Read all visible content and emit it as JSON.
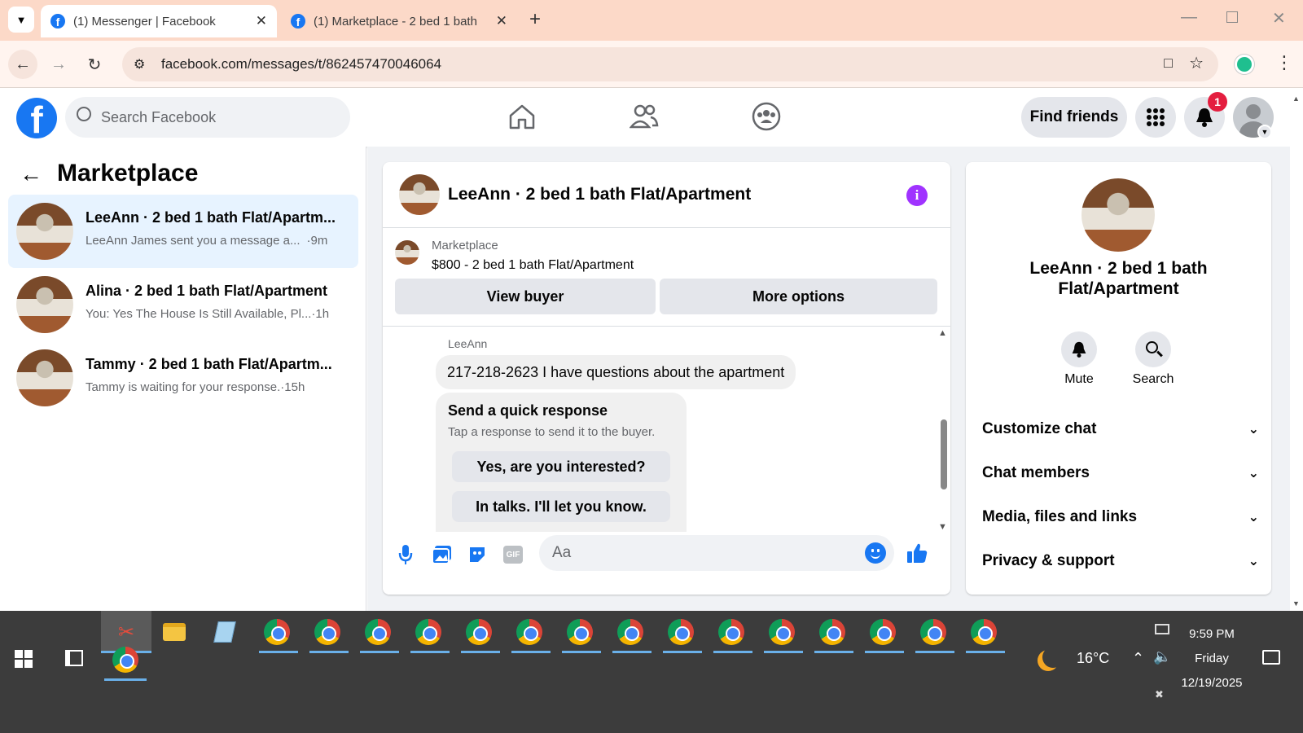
{
  "browser": {
    "tabs": [
      {
        "title": "(1) Messenger | Facebook"
      },
      {
        "title": "(1) Marketplace - 2 bed 1 bath"
      }
    ],
    "url": "facebook.com/messages/t/862457470046064"
  },
  "fb": {
    "search_placeholder": "Search Facebook",
    "find_friends": "Find friends",
    "notification_count": "1",
    "brand_color": "#1877f2"
  },
  "marketplace": {
    "title": "Marketplace",
    "conversations": [
      {
        "name": "LeeAnn · 2 bed 1 bath Flat/Apartm...",
        "preview": "LeeAnn James sent you a message a...",
        "time": "·9m"
      },
      {
        "name": "Alina · 2 bed 1 bath Flat/Apartment",
        "preview": "You: Yes The House Is Still Available, Pl...",
        "time": "·1h"
      },
      {
        "name": "Tammy · 2 bed 1 bath Flat/Apartm...",
        "preview": "Tammy is waiting for your response.",
        "time": "·15h"
      }
    ]
  },
  "chat": {
    "title": "LeeAnn · 2 bed 1 bath Flat/Apartment",
    "listing_source": "Marketplace",
    "listing_title": "$800 - 2 bed 1 bath Flat/Apartment",
    "view_buyer": "View buyer",
    "more_options": "More options",
    "sender": "LeeAnn",
    "message": "217-218-2623 I have questions about the apartment",
    "quick_title": "Send a quick response",
    "quick_subtitle": "Tap a response to send it to the buyer.",
    "quick_responses": [
      "Yes, are you interested?",
      "In talks. I'll let you know."
    ],
    "composer_placeholder": "Aa",
    "gif_label": "GIF"
  },
  "details": {
    "name": "LeeAnn · 2 bed 1 bath Flat/Apartment",
    "mute": "Mute",
    "search": "Search",
    "sections": [
      "Customize chat",
      "Chat members",
      "Media, files and links",
      "Privacy & support"
    ]
  },
  "taskbar": {
    "weather": "16°C",
    "time": "9:59 PM",
    "day": "Friday",
    "date": "12/19/2025"
  }
}
